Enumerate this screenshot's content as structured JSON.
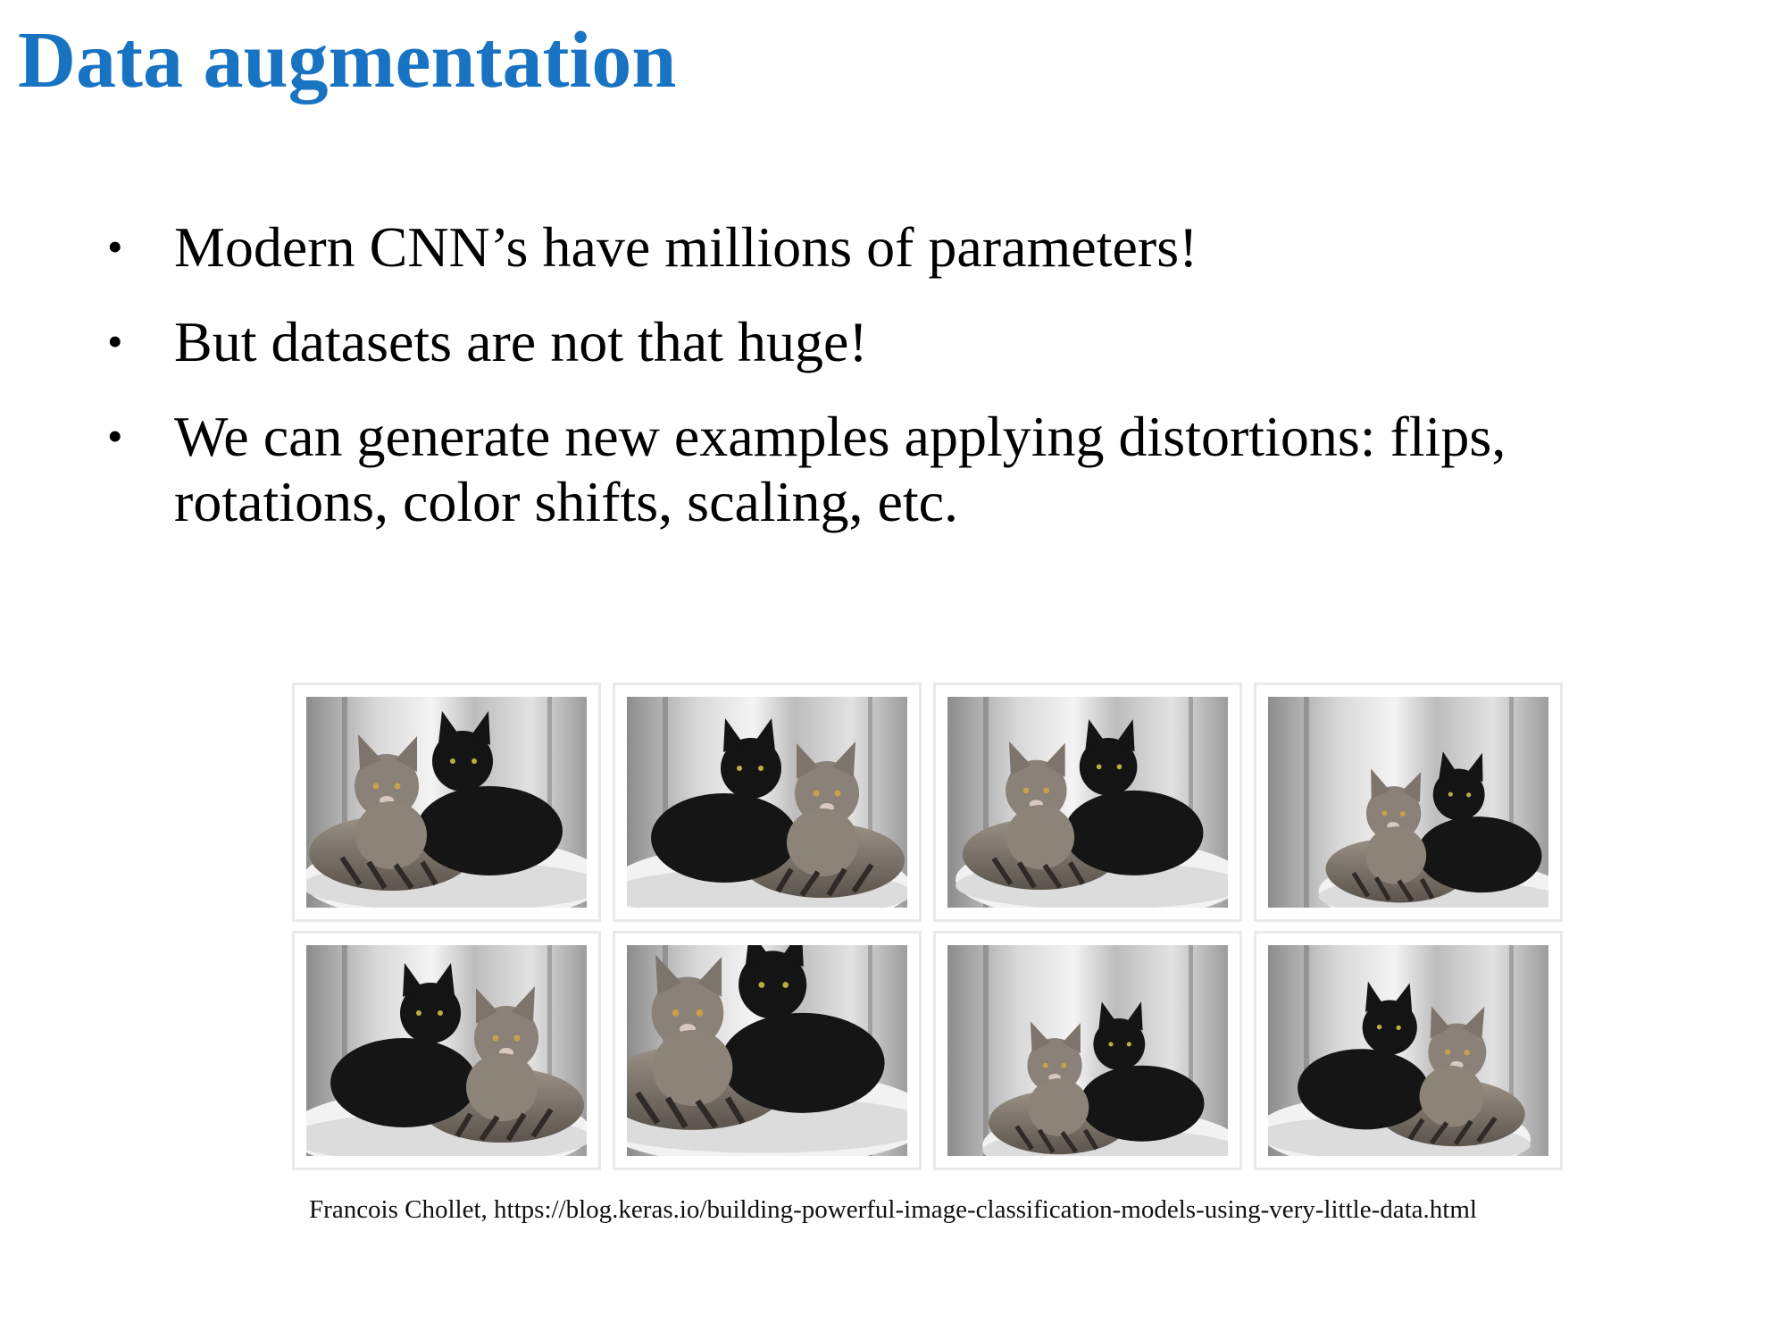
{
  "slide": {
    "title": "Data augmentation",
    "title_color": "#1874c2",
    "bullets": [
      "Modern CNN’s have millions of parameters!",
      "But datasets are not that huge!",
      "We can generate new examples applying distortions: flips, rotations, color shifts, scaling, etc."
    ],
    "bullet_symbol": "•",
    "image_grid": {
      "rows": 2,
      "columns": 4,
      "tiles": [
        {
          "subject": "cat-photo",
          "mirrored": false
        },
        {
          "subject": "cat-photo",
          "mirrored": true
        },
        {
          "subject": "cat-photo",
          "mirrored": false
        },
        {
          "subject": "cat-photo",
          "mirrored": false
        },
        {
          "subject": "cat-photo",
          "mirrored": true
        },
        {
          "subject": "cat-photo",
          "mirrored": false
        },
        {
          "subject": "cat-photo",
          "mirrored": false
        },
        {
          "subject": "cat-photo",
          "mirrored": true
        }
      ]
    },
    "credit": "Francois Chollet, https://blog.keras.io/building-powerful-image-classification-models-using-very-little-data.html"
  }
}
